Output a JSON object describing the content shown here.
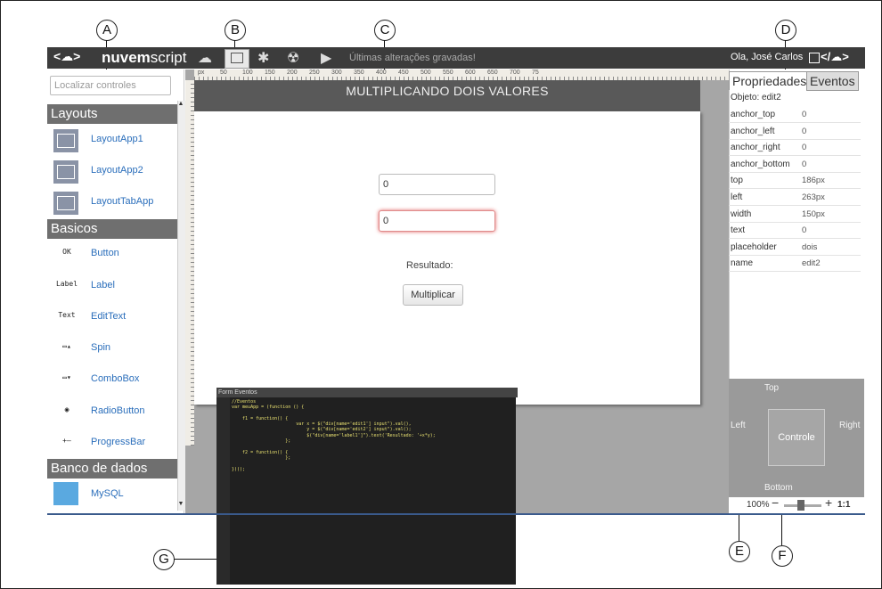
{
  "callouts": [
    "A",
    "B",
    "C",
    "D",
    "E",
    "F",
    "G"
  ],
  "topbar": {
    "logo_left": "<☁>",
    "brand_bold": "nuvem",
    "brand_rest": "script",
    "status": "Últimas alterações gravadas!",
    "user": "Ola, José Carlos",
    "logo_right": "</☁>"
  },
  "left": {
    "search_placeholder": "Localizar controles",
    "sections": {
      "layouts": "Layouts",
      "basicos": "Basicos",
      "banco": "Banco de dados"
    },
    "layout_items": [
      "LayoutApp1",
      "LayoutApp2",
      "LayoutTabApp"
    ],
    "basic_items": [
      {
        "label": "Button",
        "glyph": "OK"
      },
      {
        "label": "Label",
        "glyph": "Label"
      },
      {
        "label": "EditText",
        "glyph": "Text"
      },
      {
        "label": "Spin",
        "glyph": "▭▴"
      },
      {
        "label": "ComboBox",
        "glyph": "▭▾"
      },
      {
        "label": "RadioButton",
        "glyph": "◉"
      },
      {
        "label": "ProgressBar",
        "glyph": "+—"
      }
    ],
    "db_items": [
      {
        "label": "MySQL",
        "glyph": "MySQL"
      }
    ]
  },
  "ruler_ticks": [
    "px",
    "50",
    "100",
    "150",
    "200",
    "250",
    "300",
    "350",
    "400",
    "450",
    "500",
    "550",
    "600",
    "650",
    "700",
    "75"
  ],
  "form": {
    "title": "MULTIPLICANDO DOIS VALORES",
    "edit1_value": "0",
    "edit2_value": "0",
    "result_label": "Resultado:",
    "button": "Multiplicar"
  },
  "editor": {
    "tab": "Form Eventos",
    "code": "//Eventos\nvar meuApp = (function () {\n\n    f1 = function() {\n                        var x = $(\"div[name='edit1'] input\").val(),\n                            y = $(\"div[name='edit2'] input\").val();\n                            $(\"div[name='label1']\").text('Resultado: '+x*y);\n                    };\n\n    f2 = function() {\n                    };\n\n})();"
  },
  "props": {
    "tab_active": "Propriedades",
    "tab_other": "Eventos",
    "object": "Objeto: edit2",
    "rows": [
      {
        "k": "anchor_top",
        "v": "0"
      },
      {
        "k": "anchor_left",
        "v": "0"
      },
      {
        "k": "anchor_right",
        "v": "0"
      },
      {
        "k": "anchor_bottom",
        "v": "0"
      },
      {
        "k": "top",
        "v": "186px"
      },
      {
        "k": "left",
        "v": "263px"
      },
      {
        "k": "width",
        "v": "150px"
      },
      {
        "k": "text",
        "v": "0"
      },
      {
        "k": "placeholder",
        "v": "dois"
      },
      {
        "k": "name",
        "v": "edit2"
      }
    ]
  },
  "anchor": {
    "top": "Top",
    "left": "Left",
    "right": "Right",
    "bottom": "Bottom",
    "control": "Controle"
  },
  "zoom": {
    "level": "100%",
    "ratio": "1:1",
    "slider_fraction": 0.45
  },
  "colors": {
    "topbar": "#3c3c3c",
    "section": "#6f6f6f",
    "link": "#2a6ebb",
    "canvas": "#a6a6a6"
  }
}
